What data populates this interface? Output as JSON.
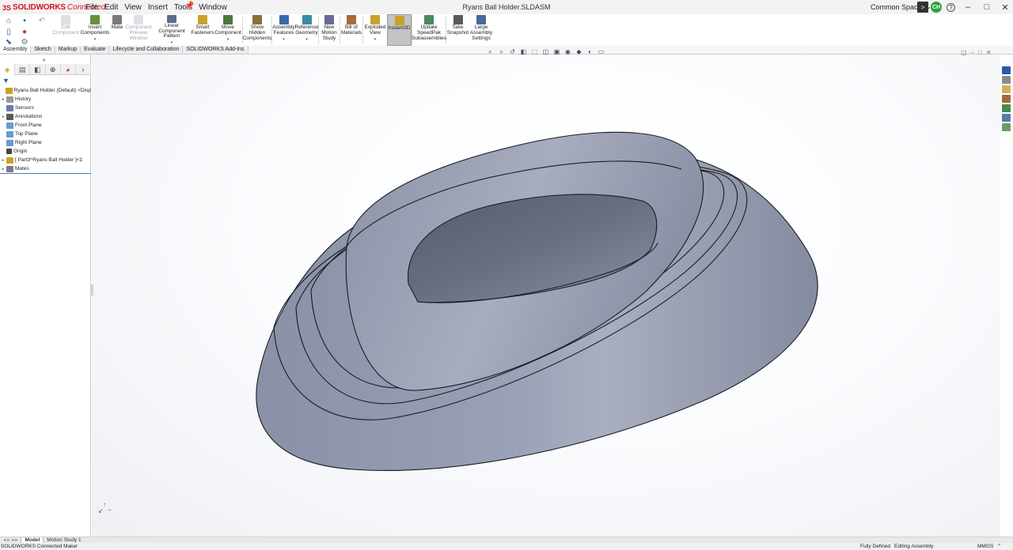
{
  "app": {
    "logo_ds": "3S",
    "logo_name": "SOLIDWORKS",
    "logo_suffix": "Connected",
    "document_title": "Ryans Ball Holder.SLDASM",
    "workspace": "Common Space",
    "user_initials": "CH"
  },
  "menu": [
    "File",
    "Edit",
    "View",
    "Insert",
    "Tools",
    "Window"
  ],
  "command_manager": [
    {
      "label": "Edit Component",
      "disabled": true,
      "color": "#9aa7b8"
    },
    {
      "label": "Insert Components",
      "disabled": false,
      "dropdown": true,
      "color": "#6a8f3a"
    },
    {
      "label": "Mate",
      "disabled": false,
      "color": "#7a7a7a"
    },
    {
      "label": "Component Preview Window",
      "disabled": true,
      "color": "#9aa7b8"
    },
    {
      "label": "Linear Component Pattern",
      "disabled": false,
      "dropdown": true,
      "color": "#5a6f8f"
    },
    {
      "label": "Smart Fasteners",
      "disabled": false,
      "color": "#c9a227"
    },
    {
      "label": "Move Component",
      "disabled": false,
      "dropdown": true,
      "color": "#4a7a3a"
    },
    {
      "label": "Show Hidden Components",
      "disabled": false,
      "color": "#8a6f3a"
    },
    {
      "label": "Assembly Features",
      "disabled": false,
      "dropdown": true,
      "color": "#3a6aa8"
    },
    {
      "label": "Reference Geometry",
      "disabled": false,
      "dropdown": true,
      "color": "#3a8aa8"
    },
    {
      "label": "New Motion Study",
      "disabled": false,
      "color": "#6a6a9a"
    },
    {
      "label": "Bill of Materials",
      "disabled": false,
      "color": "#a86a3a"
    },
    {
      "label": "Exploded View",
      "disabled": false,
      "dropdown": true,
      "color": "#c9a227"
    },
    {
      "label": "Instant3D",
      "disabled": false,
      "active": true,
      "color": "#c9a227"
    },
    {
      "label": "Update SpeedPak Subassemblies",
      "disabled": false,
      "color": "#4a8a5a"
    },
    {
      "label": "Take Snapshot",
      "disabled": false,
      "color": "#5a5a5a"
    },
    {
      "label": "Large Assembly Settings",
      "disabled": false,
      "color": "#4a6a9a"
    }
  ],
  "command_tabs": [
    "Assembly",
    "Sketch",
    "Markup",
    "Evaluate",
    "Lifecycle and Collaboration",
    "SOLIDWORKS Add-Ins"
  ],
  "feature_tree": [
    {
      "label": "Ryans Ball Holder (Default) <Disp",
      "expander": "",
      "icon_color": "#c9a227",
      "indent": 0
    },
    {
      "label": "History",
      "expander": "▸",
      "icon_color": "#9a9a9a",
      "indent": 0
    },
    {
      "label": "Sensors",
      "expander": "",
      "icon_color": "#6a7aa8",
      "indent": 0
    },
    {
      "label": "Annotations",
      "expander": "▸",
      "icon_color": "#5a5a5a",
      "indent": 0
    },
    {
      "label": "Front Plane",
      "expander": "",
      "icon_color": "#6a9ad0",
      "indent": 0
    },
    {
      "label": "Top Plane",
      "expander": "",
      "icon_color": "#6a9ad0",
      "indent": 0
    },
    {
      "label": "Right Plane",
      "expander": "",
      "icon_color": "#6a9ad0",
      "indent": 0
    },
    {
      "label": "Origin",
      "expander": "",
      "icon_color": "#444444",
      "indent": 0
    },
    {
      "label": "[ Part3^Ryans Ball Holder ]<1",
      "expander": "▸",
      "icon_color": "#c9a227",
      "indent": 0
    },
    {
      "label": "Mates",
      "expander": "▸",
      "icon_color": "#7a7a7a",
      "indent": 0
    }
  ],
  "model_tabs": [
    "Model",
    "Motion Study 1"
  ],
  "status": {
    "left": "SOLIDWORKS Connected Maker",
    "defined": "Fully Defined",
    "mode": "Editing Assembly",
    "units": "MMGS"
  },
  "colors": {
    "part_fill": "#8c93a8",
    "part_edge": "#1b1d22",
    "accent": "#d1131f"
  }
}
